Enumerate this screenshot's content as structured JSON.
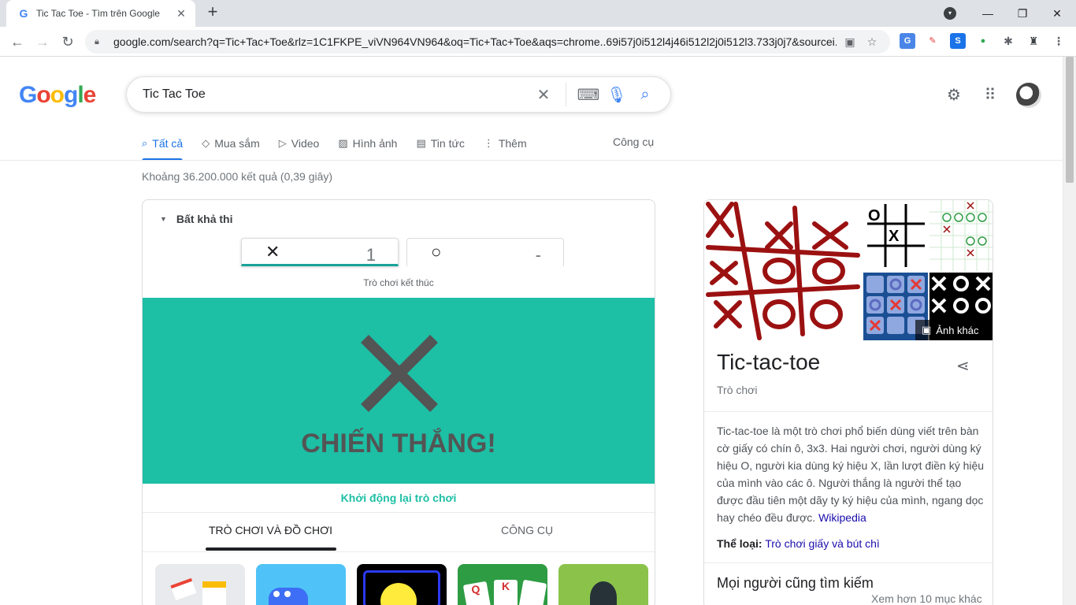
{
  "browser": {
    "tab_title": "Tic Tac Toe - Tìm trên Google",
    "tab_close": "✕",
    "new_tab": "+",
    "url": "google.com/search?q=Tic+Tac+Toe&rlz=1C1FKPE_viVN964VN964&oq=Tic+Tac+Toe&aqs=chrome..69i57j0i512l4j46i512l2j0i512l3.733j0j7&sourcei..."
  },
  "search": {
    "logo": "Google",
    "query": "Tic Tac Toe",
    "tabs": [
      {
        "label": "Tất cả",
        "icon": "search-icon"
      },
      {
        "label": "Mua sắm",
        "icon": "tag-icon"
      },
      {
        "label": "Video",
        "icon": "video-icon"
      },
      {
        "label": "Hình ảnh",
        "icon": "image-icon"
      },
      {
        "label": "Tin tức",
        "icon": "news-icon"
      },
      {
        "label": "Thêm",
        "icon": "more-icon"
      }
    ],
    "tools": "Công cụ",
    "stats": "Khoảng 36.200.000 kết quả (0,39 giây)"
  },
  "game": {
    "difficulty": "Bất khả thi",
    "player_x_symbol": "✕",
    "player_x_score": "1",
    "player_o_symbol": "○",
    "player_o_score": "-",
    "status": "Trò chơi kết thúc",
    "result": "CHIẾN THẮNG!",
    "restart": "Khởi động lại trò chơi",
    "tabs": [
      "TRÒ CHƠI VÀ ĐỒ CHƠI",
      "CÔNG CỤ"
    ],
    "colors": {
      "board": "#1dbfa5",
      "mark": "#545454"
    }
  },
  "knowledge_panel": {
    "more_images": "Ảnh khác",
    "title": "Tic-tac-toe",
    "subtitle": "Trò chơi",
    "description": "Tic-tac-toe là một trò chơi phổ biến dùng viết trên bàn cờ giấy có chín ô, 3x3. Hai người chơi, người dùng ký hiệu O, người kia dùng ký hiệu X, lần lượt điền ký hiệu của mình vào các ô. Người thắng là người thể tạo được đầu tiên một dãy ty ký hiệu của mình, ngang dọc hay chéo đều được.",
    "wiki_link": "Wikipedia",
    "genre_label": "Thể loại:",
    "genre_value": "Trò chơi giấy và bút chì",
    "also_search": "Mọi người cũng tìm kiếm",
    "see_more": "Xem hơn 10 mục khác"
  }
}
